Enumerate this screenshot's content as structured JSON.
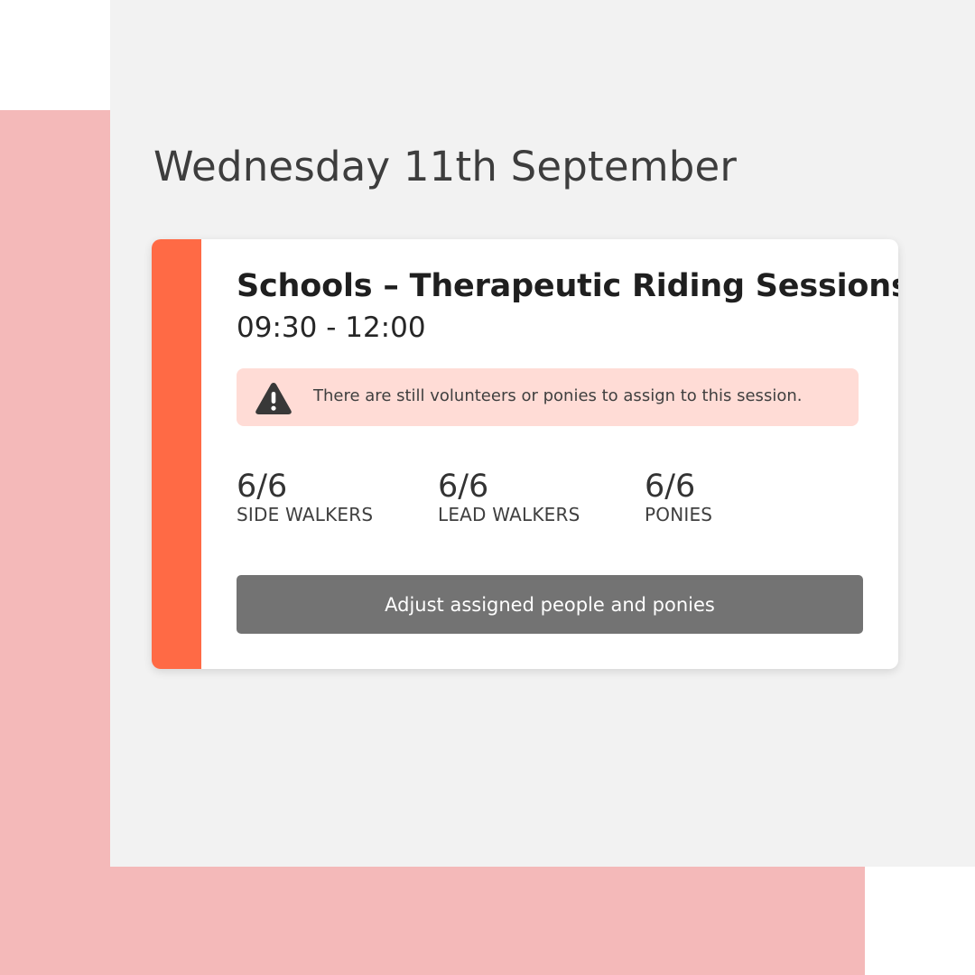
{
  "colors": {
    "pink_backdrop": "#f4b9b9",
    "panel_background": "#f2f2f2",
    "session_accent": "#ff6a45",
    "alert_background": "#ffdcd6",
    "button_background": "#737373",
    "warning_icon": "#383838"
  },
  "date_heading": "Wednesday 11th September",
  "session": {
    "title": "Schools – Therapeutic Riding Sessions",
    "time": "09:30 - 12:00",
    "alert": {
      "icon": "warning-triangle-icon",
      "text": "There are still volunteers or ponies to assign to this session."
    },
    "stats": [
      {
        "value": "6/6",
        "label": "SIDE WALKERS"
      },
      {
        "value": "6/6",
        "label": "LEAD WALKERS"
      },
      {
        "value": "6/6",
        "label": "PONIES"
      }
    ],
    "button_label": "Adjust assigned people and ponies"
  }
}
